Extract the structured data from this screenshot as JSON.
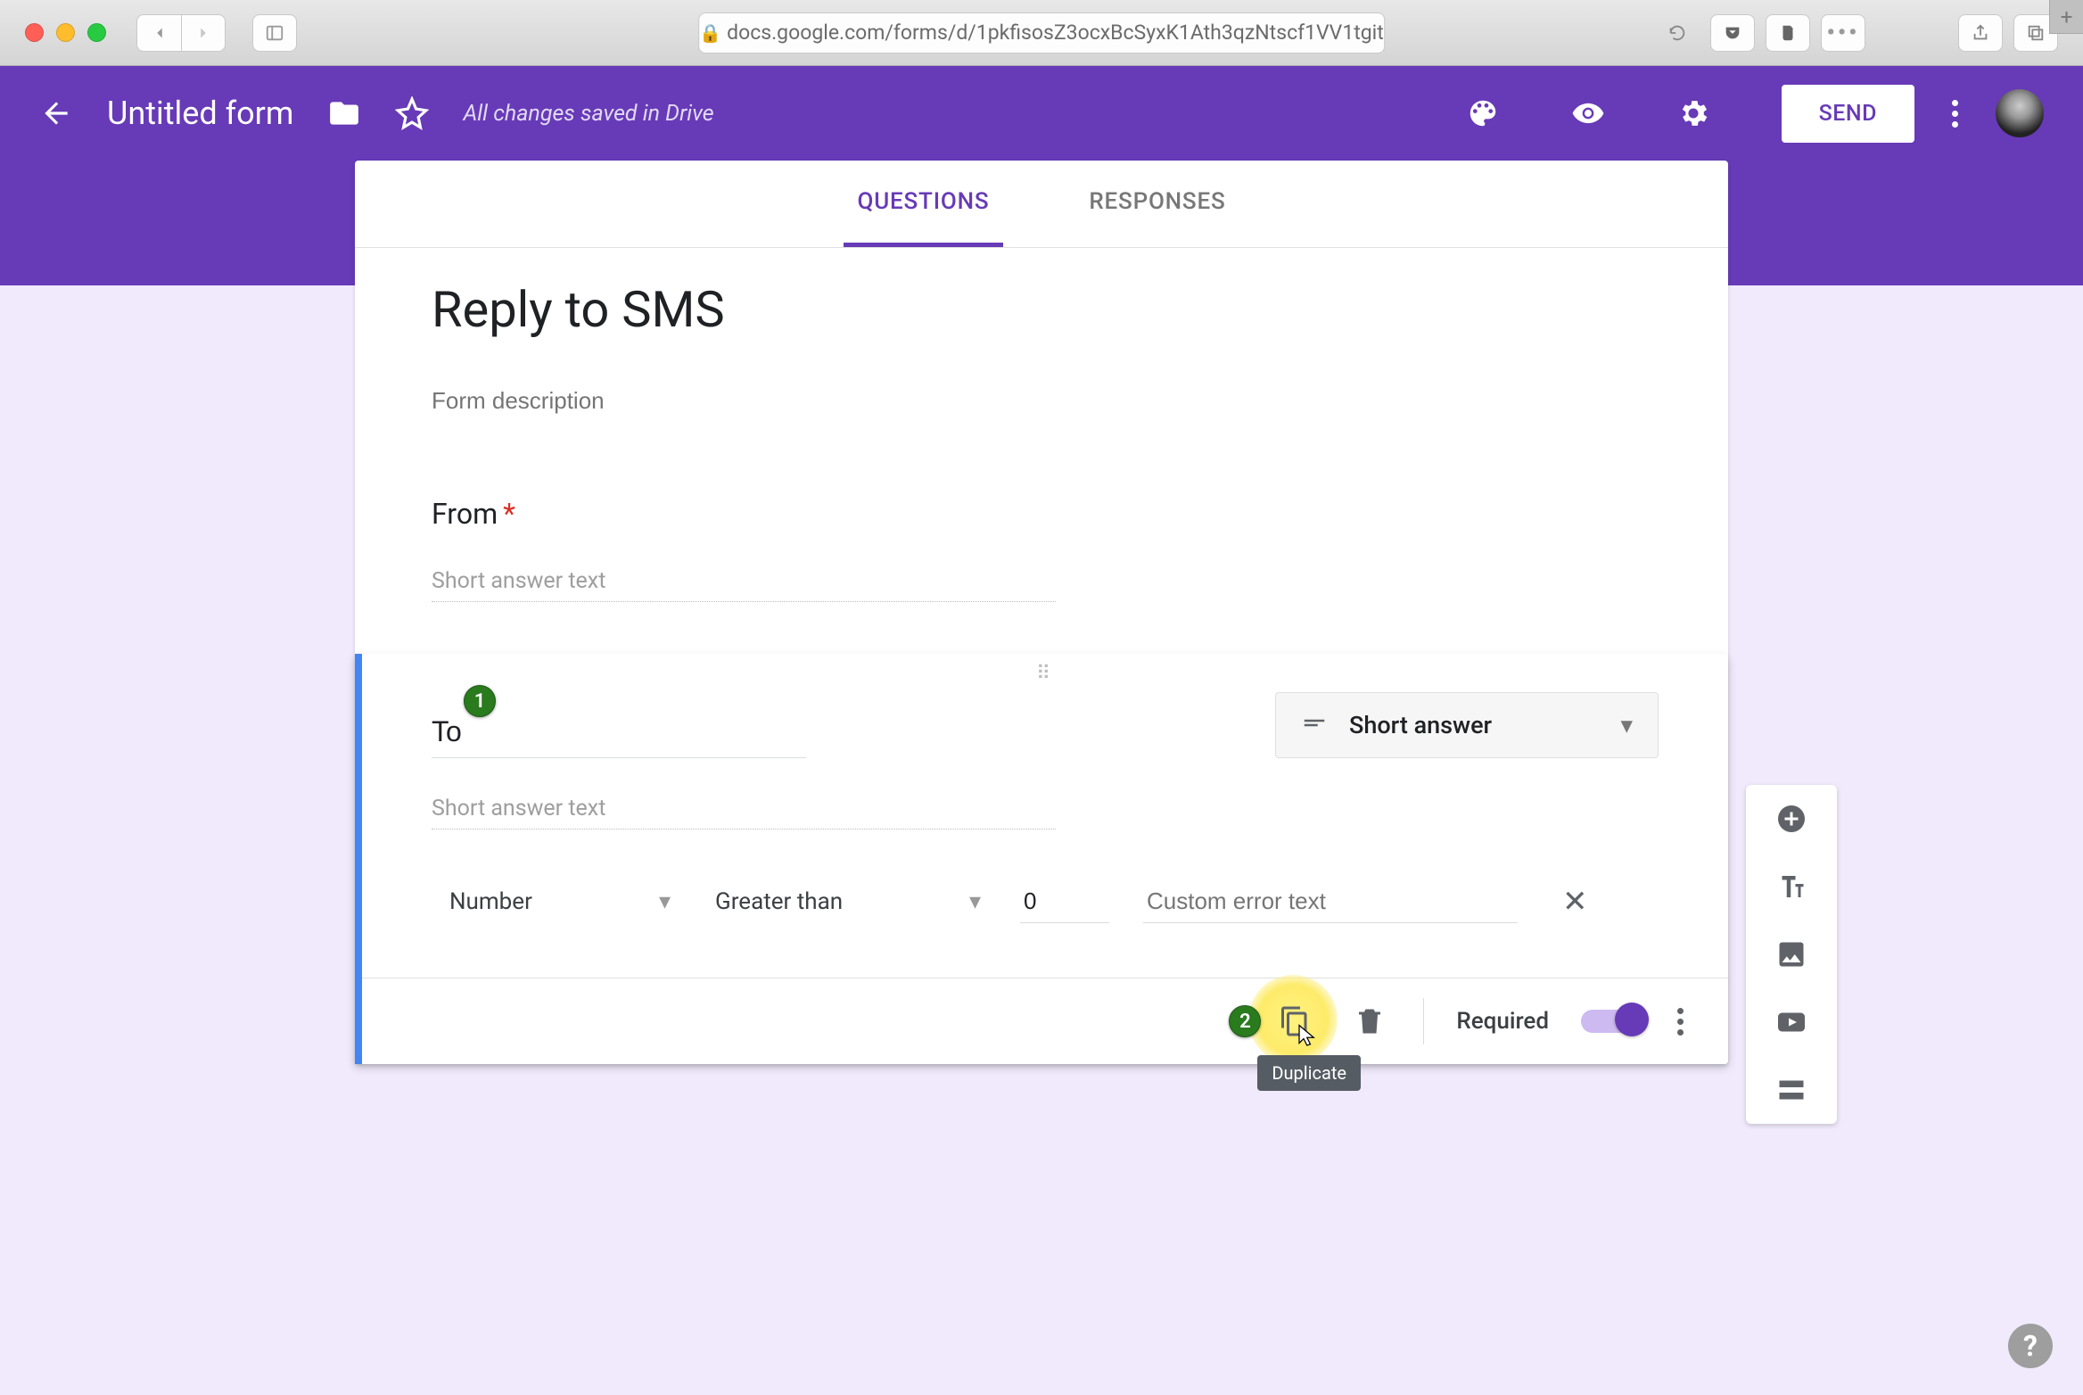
{
  "browser": {
    "url": "docs.google.com/forms/d/1pkfisosZ3ocxBcSyxK1Ath3qzNtscf1VV1tgit"
  },
  "header": {
    "doc_title": "Untitled form",
    "save_status": "All changes saved in Drive",
    "send_label": "SEND"
  },
  "tabs": {
    "questions": "QUESTIONS",
    "responses": "RESPONSES"
  },
  "form": {
    "title": "Reply to SMS",
    "description_placeholder": "Form description"
  },
  "question1": {
    "label": "From",
    "answer_hint": "Short answer text"
  },
  "question2": {
    "title": "To",
    "answer_hint": "Short answer text",
    "type_label": "Short answer",
    "validation": {
      "category": "Number",
      "operator": "Greater than",
      "value": "0",
      "error_placeholder": "Custom error text"
    },
    "required_label": "Required",
    "required_on": true,
    "tooltip": "Duplicate"
  },
  "annotations": {
    "badge1": "1",
    "badge2": "2"
  },
  "help": "?"
}
